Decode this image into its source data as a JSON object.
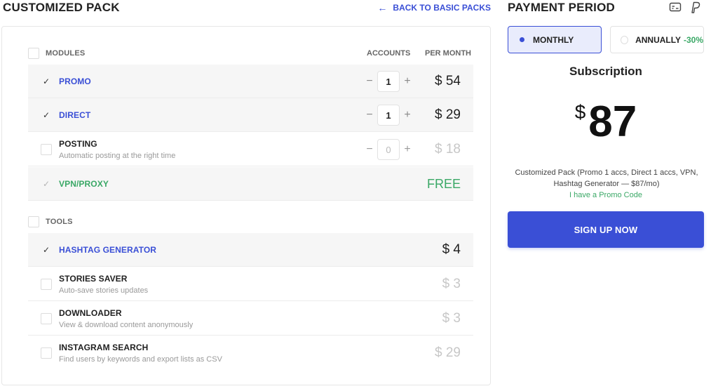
{
  "header": {
    "title": "CUSTOMIZED PACK",
    "back_link": "BACK TO BASIC PACKS",
    "back_arrow": "←"
  },
  "modules": {
    "section_label": "MODULES",
    "col_accounts": "ACCOUNTS",
    "col_per_month": "PER MONTH",
    "items": [
      {
        "name": "PROMO",
        "desc": "",
        "checked": true,
        "accounts": "1",
        "price": "$ 54"
      },
      {
        "name": "DIRECT",
        "desc": "",
        "checked": true,
        "accounts": "1",
        "price": "$ 29"
      },
      {
        "name": "POSTING",
        "desc": "Automatic posting at the right time",
        "checked": false,
        "accounts": "0",
        "price": "$ 18"
      },
      {
        "name": "VPN/PROXY",
        "desc": "",
        "checked": true,
        "price": "FREE"
      }
    ]
  },
  "tools": {
    "section_label": "TOOLS",
    "items": [
      {
        "name": "HASHTAG GENERATOR",
        "desc": "",
        "checked": true,
        "price": "$ 4"
      },
      {
        "name": "STORIES SAVER",
        "desc": "Auto-save stories updates",
        "checked": false,
        "price": "$ 3"
      },
      {
        "name": "DOWNLOADER",
        "desc": "View & download content anonymously",
        "checked": false,
        "price": "$ 3"
      },
      {
        "name": "INSTAGRAM SEARCH",
        "desc": "Find users by keywords and export lists as CSV",
        "checked": false,
        "price": "$ 29"
      }
    ]
  },
  "stepper": {
    "minus": "−",
    "plus": "+"
  },
  "payment": {
    "title": "PAYMENT PERIOD",
    "icons": [
      "credit-card-icon",
      "paypal-icon"
    ],
    "monthly_label": "MONTHLY",
    "annually_label": "ANNUALLY",
    "annually_discount": "-30%",
    "selected": "monthly",
    "subscription_title": "Subscription",
    "currency": "$",
    "total": "87",
    "summary": "Customized Pack (Promo 1 accs, Direct 1 accs, VPN, Hashtag Generator — $87/mo)",
    "promo_link": "I have a Promo Code",
    "signup_label": "SIGN UP NOW"
  },
  "colors": {
    "accent": "#3a4fd6",
    "accent_light": "#e9ecfc",
    "green": "#3aa866",
    "muted": "#c7c7c7"
  }
}
